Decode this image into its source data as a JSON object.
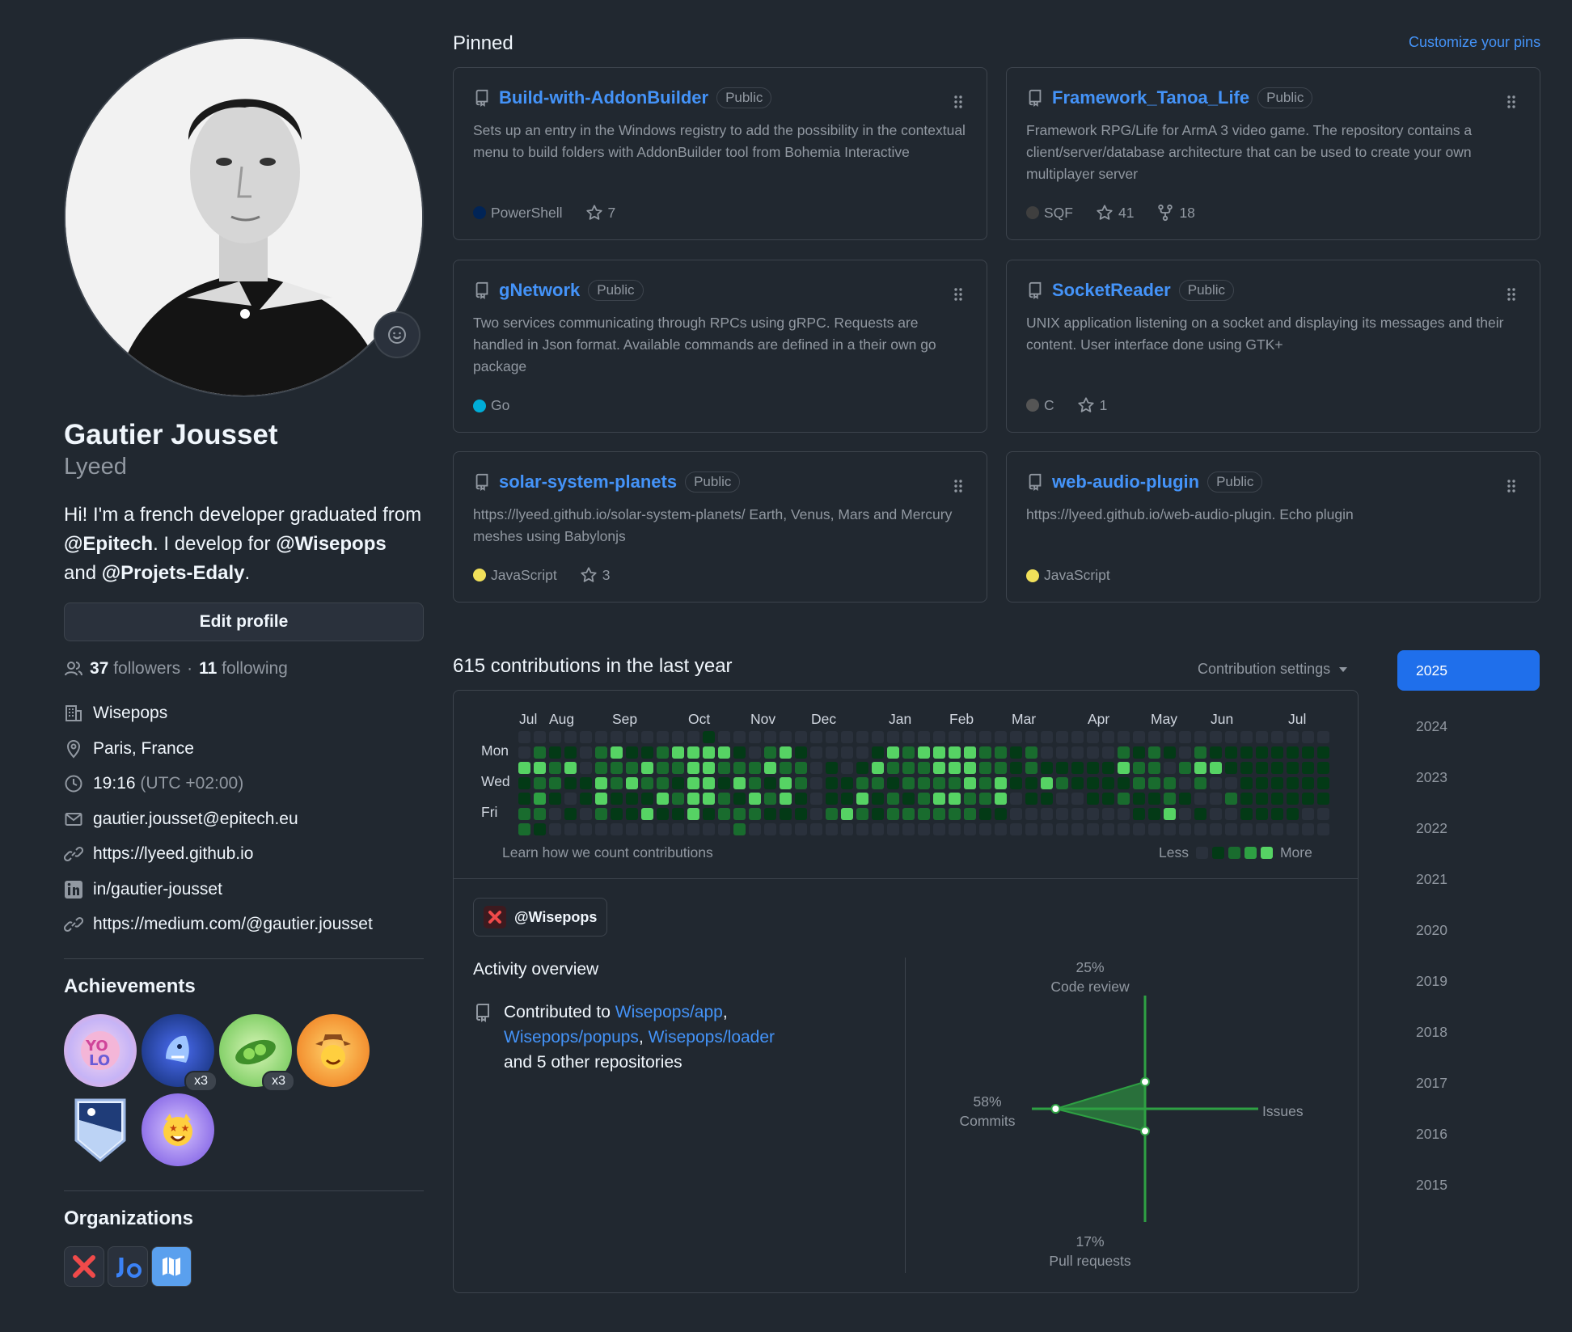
{
  "profile": {
    "fullname": "Gautier Jousset",
    "username": "Lyeed",
    "bio_prefix": "Hi! I'm a french developer graduated from ",
    "bio_org1": "@Epitech",
    "bio_mid": ". I develop for ",
    "bio_org2": "@Wisepops",
    "bio_and": " and ",
    "bio_org3": "@Projets-Edaly",
    "bio_end": ".",
    "edit_label": "Edit profile",
    "followers_count": "37",
    "followers_label": "followers",
    "following_count": "11",
    "following_label": "following",
    "dot_sep": "·",
    "company": "Wisepops",
    "location": "Paris, France",
    "time": "19:16",
    "timezone": "(UTC +02:00)",
    "email": "gautier.jousset@epitech.eu",
    "website": "https://lyeed.github.io",
    "linkedin": "in/gautier-jousset",
    "medium": "https://medium.com/@gautier.jousset"
  },
  "achievements": {
    "title": "Achievements",
    "badges": [
      {
        "icon": "yolo-badge-icon",
        "mult": ""
      },
      {
        "icon": "shark-badge-icon",
        "mult": "x3"
      },
      {
        "icon": "pair-extraordinaire-badge-icon",
        "mult": "x3"
      },
      {
        "icon": "quickdraw-badge-icon",
        "mult": ""
      },
      {
        "icon": "arctic-code-vault-badge-icon",
        "mult": ""
      },
      {
        "icon": "starstruck-badge-icon",
        "mult": ""
      }
    ]
  },
  "organizations": {
    "title": "Organizations",
    "items": [
      "wisepops-org-icon",
      "projets-edaly-org-icon",
      "epitech-org-icon"
    ]
  },
  "pinned": {
    "title": "Pinned",
    "customize": "Customize your pins",
    "public_label": "Public",
    "repos": [
      {
        "name": "Build-with-AddonBuilder",
        "desc": "Sets up an entry in the Windows registry to add the possibility in the contextual menu to build folders with AddonBuilder tool from Bohemia Interactive",
        "lang": "PowerShell",
        "lang_color": "#012456",
        "stars": "7",
        "forks": ""
      },
      {
        "name": "Framework_Tanoa_Life",
        "desc": "Framework RPG/Life for ArmA 3 video game. The repository contains a client/server/database architecture that can be used to create your own multiplayer server",
        "lang": "SQF",
        "lang_color": "#3f3f3f",
        "stars": "41",
        "forks": "18"
      },
      {
        "name": "gNetwork",
        "desc": "Two services communicating through RPCs using gRPC. Requests are handled in Json format. Available commands are defined in a their own go package",
        "lang": "Go",
        "lang_color": "#00ADD8",
        "stars": "",
        "forks": ""
      },
      {
        "name": "SocketReader",
        "desc": "UNIX application listening on a socket and displaying its messages and their content. User interface done using GTK+",
        "lang": "C",
        "lang_color": "#555555",
        "stars": "1",
        "forks": ""
      },
      {
        "name": "solar-system-planets",
        "desc": "https://lyeed.github.io/solar-system-planets/ Earth, Venus, Mars and Mercury meshes using Babylonjs",
        "lang": "JavaScript",
        "lang_color": "#f1e05a",
        "stars": "3",
        "forks": ""
      },
      {
        "name": "web-audio-plugin",
        "desc": "https://lyeed.github.io/web-audio-plugin. Echo plugin",
        "lang": "JavaScript",
        "lang_color": "#f1e05a",
        "stars": "",
        "forks": ""
      }
    ]
  },
  "contributions": {
    "title": "615 contributions in the last year",
    "settings": "Contribution settings",
    "months": [
      "Jul",
      "Aug",
      "Sep",
      "Oct",
      "Nov",
      "Dec",
      "Jan",
      "Feb",
      "Mar",
      "Apr",
      "May",
      "Jun",
      "Jul"
    ],
    "days": [
      "Mon",
      "Wed",
      "Fri"
    ],
    "learn": "Learn how we count contributions",
    "less": "Less",
    "more": "More",
    "level_colors": [
      "#2a313c",
      "#033a16",
      "#196c2e",
      "#2ea043",
      "#56d364"
    ],
    "weeks": [
      [
        0,
        0,
        4,
        1,
        1,
        2,
        2
      ],
      [
        0,
        2,
        4,
        2,
        3,
        2,
        1
      ],
      [
        0,
        1,
        2,
        2,
        1,
        0,
        0
      ],
      [
        0,
        1,
        4,
        1,
        0,
        1,
        0
      ],
      [
        0,
        0,
        0,
        1,
        1,
        0,
        0
      ],
      [
        0,
        2,
        2,
        4,
        4,
        2,
        0
      ],
      [
        0,
        4,
        2,
        2,
        1,
        1,
        0
      ],
      [
        0,
        1,
        2,
        4,
        1,
        1,
        0
      ],
      [
        0,
        1,
        4,
        2,
        1,
        4,
        0
      ],
      [
        0,
        2,
        2,
        2,
        4,
        1,
        0
      ],
      [
        0,
        4,
        2,
        1,
        2,
        1,
        0
      ],
      [
        0,
        4,
        4,
        4,
        4,
        4,
        0
      ],
      [
        1,
        4,
        4,
        4,
        4,
        1,
        0
      ],
      [
        0,
        4,
        2,
        1,
        2,
        2,
        0
      ],
      [
        0,
        1,
        2,
        4,
        1,
        2,
        2
      ],
      [
        0,
        0,
        2,
        2,
        4,
        2,
        0
      ],
      [
        0,
        2,
        4,
        1,
        2,
        1,
        0
      ],
      [
        0,
        4,
        2,
        4,
        4,
        1,
        0
      ],
      [
        0,
        1,
        2,
        2,
        1,
        1,
        0
      ],
      [
        0,
        0,
        0,
        0,
        0,
        0,
        0
      ],
      [
        0,
        0,
        1,
        1,
        1,
        2,
        0
      ],
      [
        0,
        0,
        0,
        1,
        1,
        4,
        0
      ],
      [
        0,
        0,
        1,
        2,
        4,
        2,
        0
      ],
      [
        0,
        1,
        4,
        2,
        1,
        1,
        0
      ],
      [
        0,
        4,
        2,
        1,
        2,
        2,
        0
      ],
      [
        0,
        2,
        2,
        2,
        1,
        2,
        0
      ],
      [
        0,
        4,
        2,
        2,
        2,
        2,
        0
      ],
      [
        0,
        4,
        4,
        2,
        4,
        2,
        0
      ],
      [
        0,
        4,
        4,
        2,
        4,
        2,
        0
      ],
      [
        0,
        4,
        4,
        4,
        2,
        2,
        0
      ],
      [
        0,
        2,
        2,
        2,
        2,
        1,
        0
      ],
      [
        0,
        2,
        2,
        4,
        4,
        1,
        0
      ],
      [
        0,
        1,
        1,
        1,
        0,
        0,
        0
      ],
      [
        0,
        2,
        2,
        1,
        1,
        0,
        0
      ],
      [
        0,
        0,
        1,
        4,
        1,
        0,
        0
      ],
      [
        0,
        0,
        1,
        2,
        0,
        0,
        0
      ],
      [
        0,
        0,
        1,
        1,
        0,
        0,
        0
      ],
      [
        0,
        0,
        1,
        1,
        1,
        0,
        0
      ],
      [
        0,
        0,
        1,
        1,
        1,
        0,
        0
      ],
      [
        0,
        2,
        4,
        1,
        2,
        0,
        0
      ],
      [
        0,
        1,
        2,
        2,
        1,
        1,
        0
      ],
      [
        0,
        2,
        2,
        2,
        1,
        1,
        0
      ],
      [
        0,
        1,
        0,
        2,
        2,
        4,
        0
      ],
      [
        0,
        0,
        2,
        0,
        1,
        0,
        0
      ],
      [
        0,
        2,
        4,
        2,
        0,
        1,
        0
      ],
      [
        0,
        1,
        4,
        0,
        0,
        0,
        0
      ],
      [
        0,
        1,
        1,
        0,
        2,
        0,
        0
      ],
      [
        0,
        1,
        1,
        1,
        1,
        1,
        0
      ],
      [
        0,
        1,
        1,
        1,
        1,
        1,
        0
      ],
      [
        0,
        1,
        1,
        1,
        1,
        1,
        0
      ],
      [
        0,
        1,
        1,
        1,
        1,
        1,
        0
      ],
      [
        0,
        1,
        1,
        1,
        1,
        0,
        0
      ],
      [
        0,
        1,
        1,
        1,
        1,
        0,
        0
      ]
    ]
  },
  "activity": {
    "org_chip": "@Wisepops",
    "title": "Activity overview",
    "contributed_to": "Contributed to ",
    "repo1": "Wisepops/app",
    "repo2": "Wisepops/popups",
    "repo3": "Wisepops/loader",
    "others": "and 5 other repositories",
    "radar": {
      "code_review_pct": "25%",
      "code_review": "Code review",
      "issues": "Issues",
      "pull_requests_pct": "17%",
      "pull_requests": "Pull requests",
      "commits_pct": "58%",
      "commits": "Commits",
      "values": {
        "code_review": 25,
        "issues": 0,
        "pull_requests": 17,
        "commits": 58
      }
    }
  },
  "years": [
    "2025",
    "2024",
    "2023",
    "2022",
    "2021",
    "2020",
    "2019",
    "2018",
    "2017",
    "2016",
    "2015"
  ],
  "colors": {
    "accent": "#4493f8",
    "bg": "#212830",
    "border": "#3d444d",
    "selected_year": "#1f6feb"
  }
}
